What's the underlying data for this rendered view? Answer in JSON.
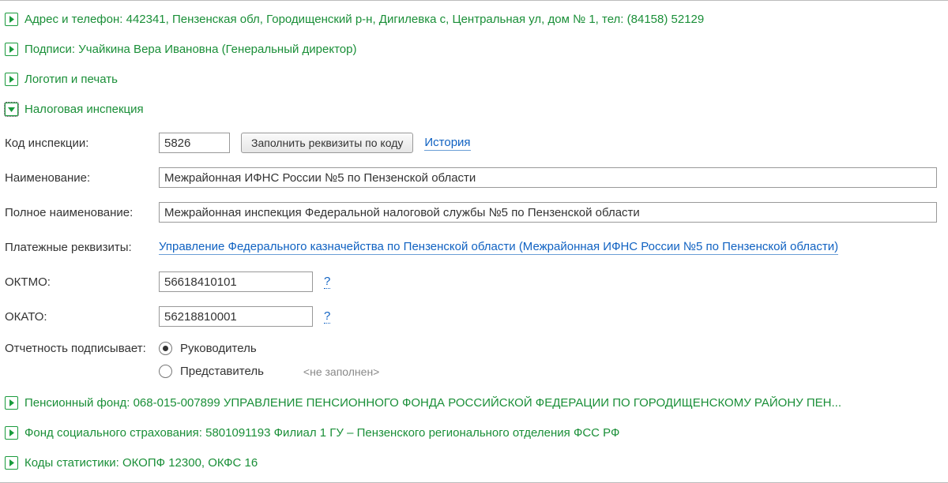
{
  "sections": {
    "address": {
      "label": "Адрес и телефон: 442341, Пензенская обл, Городищенский р-н, Дигилевка с, Центральная ул, дом № 1, тел: (84158) 52129",
      "expanded": false
    },
    "signers": {
      "label": "Подписи: Учайкина Вера Ивановна (Генеральный директор)",
      "expanded": false
    },
    "logo": {
      "label": "Логотип и печать",
      "expanded": false
    },
    "tax": {
      "label": "Налоговая инспекция",
      "expanded": true
    },
    "pension": {
      "label": "Пенсионный фонд: 068-015-007899 УПРАВЛЕНИЕ ПЕНСИОННОГО ФОНДА РОССИЙСКОЙ ФЕДЕРАЦИИ ПО ГОРОДИЩЕНСКОМУ РАЙОНУ ПЕН...",
      "expanded": false
    },
    "fss": {
      "label": "Фонд социального страхования: 5801091193 Филиал 1 ГУ – Пензенского регионального отделения ФСС РФ",
      "expanded": false
    },
    "stats": {
      "label": "Коды статистики: ОКОПФ 12300, ОКФС 16",
      "expanded": false
    }
  },
  "tax": {
    "labels": {
      "code": "Код инспекции:",
      "name": "Наименование:",
      "full_name": "Полное наименование:",
      "pay_details": "Платежные реквизиты:",
      "oktmo": "ОКТМО:",
      "okato": "ОКАТО:",
      "signer": "Отчетность подписывает:"
    },
    "actions": {
      "fill_by_code": "Заполнить реквизиты по коду",
      "history": "История",
      "help": "?"
    },
    "values": {
      "code": "5826",
      "name": "Межрайонная ИФНС России №5 по Пензенской области",
      "full_name": "Межрайонная инспекция Федеральной налоговой службы №5 по Пензенской области",
      "pay_details_link": "Управление Федерального казначейства по Пензенской области (Межрайонная ИФНС России №5 по Пензенской области)",
      "oktmo": "56618410101",
      "okato": "56218810001"
    },
    "signer_options": {
      "head": "Руководитель",
      "rep": "Представитель",
      "rep_empty": "<не заполнен>",
      "selected": "head"
    }
  }
}
